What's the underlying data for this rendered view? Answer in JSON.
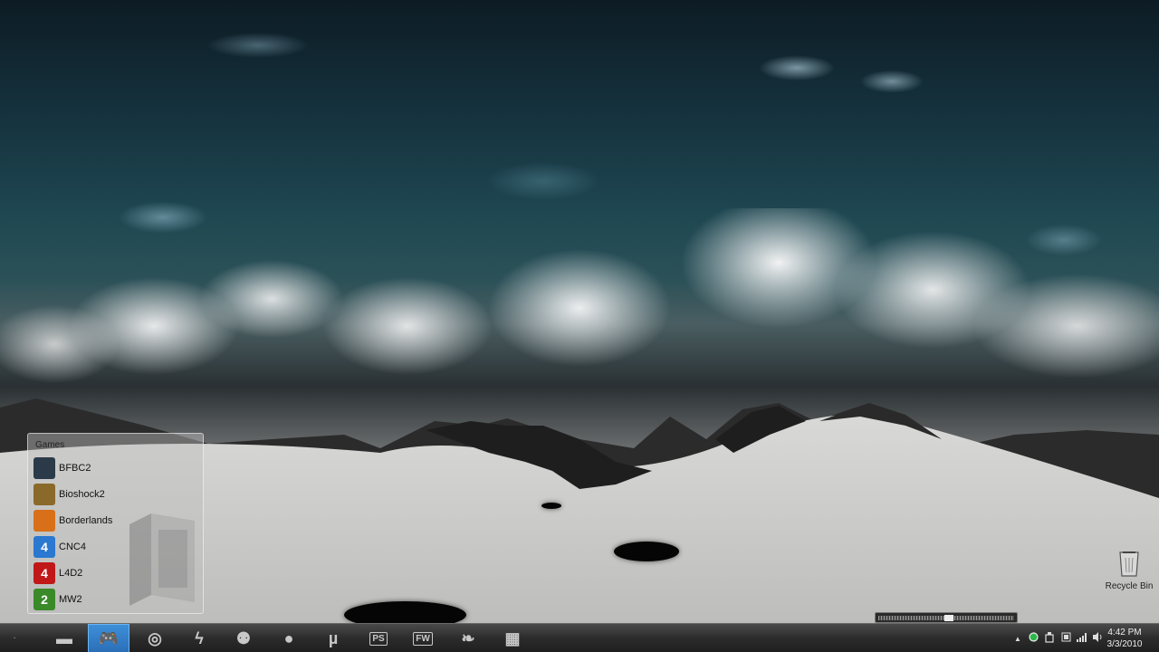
{
  "desktop": {
    "fence": {
      "title": "Games",
      "items": [
        {
          "label": "BFBC2",
          "icon": "bfbc2-icon",
          "glyph": "",
          "color": "#2b3a48"
        },
        {
          "label": "Bioshock2",
          "icon": "bioshock2-icon",
          "glyph": "",
          "color": "#8a6a2a"
        },
        {
          "label": "Borderlands",
          "icon": "borderlands-icon",
          "glyph": "",
          "color": "#d8701a"
        },
        {
          "label": "CNC4",
          "icon": "cnc4-icon",
          "glyph": "4",
          "color": "#2a78d0"
        },
        {
          "label": "L4D2",
          "icon": "l4d2-icon",
          "glyph": "4",
          "color": "#c01818"
        },
        {
          "label": "MW2",
          "icon": "mw2-icon",
          "glyph": "2",
          "color": "#3a8a2a"
        }
      ]
    },
    "recycle_bin": {
      "label": "Recycle Bin"
    },
    "gauge": {
      "level_percent": 55
    }
  },
  "taskbar": {
    "buttons": [
      {
        "name": "explorer-folder-icon",
        "glyph": "▬",
        "active": false
      },
      {
        "name": "gamepad-icon",
        "glyph": "🎮",
        "active": true
      },
      {
        "name": "chrome-icon",
        "glyph": "◎",
        "active": false
      },
      {
        "name": "lightning-icon",
        "glyph": "ϟ",
        "active": false
      },
      {
        "name": "contacts-icon",
        "glyph": "⚉",
        "active": false
      },
      {
        "name": "blob-icon",
        "glyph": "●",
        "active": false
      },
      {
        "name": "utorrent-icon",
        "glyph": "µ",
        "active": false
      },
      {
        "name": "photoshop-icon",
        "text": "PS",
        "active": false
      },
      {
        "name": "fireworks-icon",
        "text": "FW",
        "active": false
      },
      {
        "name": "feather-icon",
        "glyph": "❧",
        "active": false
      },
      {
        "name": "calculator-icon",
        "glyph": "▦",
        "active": false
      }
    ],
    "tray": {
      "time": "4:42 PM",
      "date": "3/3/2010"
    }
  },
  "colors": {
    "active_accent": "#2b6fb8",
    "taskbar": "#2c2c2c"
  }
}
